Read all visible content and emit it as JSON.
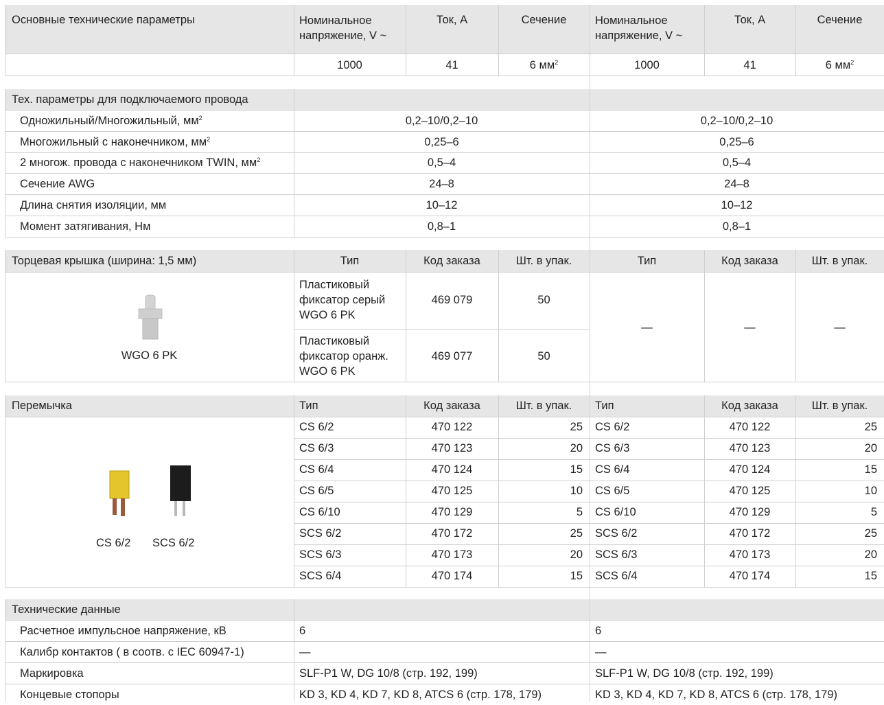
{
  "main": {
    "title": "Основные технические параметры",
    "cols": [
      {
        "voltage": "Номинальное напряжение, V ~",
        "current": "Ток, А",
        "section": "Сечение"
      },
      {
        "voltage": "Номинальное напряжение, V ~",
        "current": "Ток, А",
        "section": "Сечение"
      }
    ],
    "values": [
      {
        "voltage": "1000",
        "current": "41",
        "section": "6 мм",
        "unit_sup": "2"
      },
      {
        "voltage": "1000",
        "current": "41",
        "section": "6 мм",
        "unit_sup": "2"
      }
    ]
  },
  "wire": {
    "title": "Тех. параметры для подключаемого провода",
    "rows": [
      {
        "label": "Одножильный/Многожильный, мм",
        "sup": "2",
        "left": "0,2–10/0,2–10",
        "right": "0,2–10/0,2–10"
      },
      {
        "label": "Многожильный с наконечником, мм",
        "sup": "2",
        "left": "0,25–6",
        "right": "0,25–6"
      },
      {
        "label": "2 многож. провода с наконечником TWIN, мм",
        "sup": "2",
        "left": "0,5–4",
        "right": "0,5–4"
      },
      {
        "label": "Сечение AWG",
        "sup": "",
        "left": "24–8",
        "right": "24–8"
      },
      {
        "label": "Длина снятия изоляции, мм",
        "sup": "",
        "left": "10–12",
        "right": "10–12"
      },
      {
        "label": "Момент затягивания, Нм",
        "sup": "",
        "left": "0,8–1",
        "right": "0,8–1"
      }
    ]
  },
  "endcap": {
    "title": "Торцевая крышка (ширина: 1,5 мм)",
    "headers": {
      "type": "Тип",
      "code": "Код заказа",
      "qty": "Шт. в упак."
    },
    "image_label": "WGO 6 PK",
    "rows": [
      {
        "type": "Пластиковый фиксатор серый WGO 6 PK",
        "code": "469 079",
        "qty": "50"
      },
      {
        "type": "Пластиковый фиксатор оранж. WGO 6 PK",
        "code": "469 077",
        "qty": "50"
      }
    ],
    "right": {
      "type": "—",
      "code": "—",
      "qty": "—"
    }
  },
  "jumper": {
    "title": "Перемычка",
    "headers": {
      "type": "Тип",
      "code": "Код заказа",
      "qty": "Шт. в упак."
    },
    "image_labels": [
      "CS 6/2",
      "SCS 6/2"
    ],
    "rows": [
      {
        "type": "CS 6/2",
        "code": "470 122",
        "qty": "25"
      },
      {
        "type": "CS 6/3",
        "code": "470 123",
        "qty": "20"
      },
      {
        "type": "CS 6/4",
        "code": "470 124",
        "qty": "15"
      },
      {
        "type": "CS 6/5",
        "code": "470 125",
        "qty": "10"
      },
      {
        "type": "CS 6/10",
        "code": "470 129",
        "qty": "5"
      },
      {
        "type": "SCS 6/2",
        "code": "470 172",
        "qty": "25"
      },
      {
        "type": "SCS 6/3",
        "code": "470 173",
        "qty": "20"
      },
      {
        "type": "SCS 6/4",
        "code": "470 174",
        "qty": "15"
      }
    ]
  },
  "tech": {
    "title": "Технические данные",
    "rows": [
      {
        "label": "Расчетное импульсное напряжение, кВ",
        "left": "6",
        "right": "6"
      },
      {
        "label": "Калибр контактов ( в соотв. с IEC 60947-1)",
        "left": "—",
        "right": "—"
      },
      {
        "label": "Маркировка",
        "left": "SLF-P1 W, DG 10/8 (стр. 192, 199)",
        "right": "SLF-P1 W, DG 10/8 (стр. 192, 199)"
      },
      {
        "label": "Концевые стопоры",
        "left": "KD 3, KD 4, KD 7, KD 8, ATCS 6 (стр. 178, 179)",
        "right": "KD 3, KD 4, KD 7, KD 8, ATCS 6 (стр. 178, 179)"
      }
    ]
  },
  "colors": {
    "header_bg": "#e6e6e6",
    "grid": "#cfcfcf",
    "text": "#222222"
  }
}
